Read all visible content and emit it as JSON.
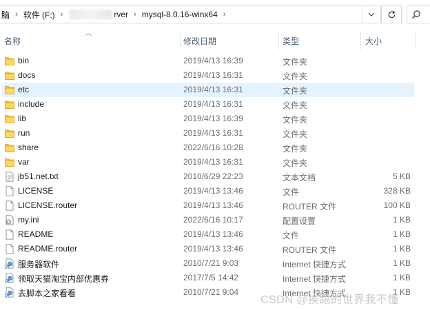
{
  "address": {
    "crumbs": [
      "脑",
      "软件 (F:)",
      "rver",
      "mysql-8.0.16-winx64"
    ],
    "separator": "›"
  },
  "columns": {
    "name": "名称",
    "date": "修改日期",
    "type": "类型",
    "size": "大小"
  },
  "files": [
    {
      "name": "bin",
      "date": "2019/4/13 16:39",
      "type": "文件夹",
      "size": "",
      "icon": "folder-icon"
    },
    {
      "name": "docs",
      "date": "2019/4/13 16:31",
      "type": "文件夹",
      "size": "",
      "icon": "folder-icon"
    },
    {
      "name": "etc",
      "date": "2019/4/13 16:31",
      "type": "文件夹",
      "size": "",
      "icon": "folder-icon",
      "selected": true
    },
    {
      "name": "include",
      "date": "2019/4/13 16:31",
      "type": "文件夹",
      "size": "",
      "icon": "folder-icon"
    },
    {
      "name": "lib",
      "date": "2019/4/13 16:39",
      "type": "文件夹",
      "size": "",
      "icon": "folder-icon"
    },
    {
      "name": "run",
      "date": "2019/4/13 16:31",
      "type": "文件夹",
      "size": "",
      "icon": "folder-icon"
    },
    {
      "name": "share",
      "date": "2022/6/16 10:28",
      "type": "文件夹",
      "size": "",
      "icon": "folder-icon"
    },
    {
      "name": "var",
      "date": "2019/4/13 16:31",
      "type": "文件夹",
      "size": "",
      "icon": "folder-icon"
    },
    {
      "name": "jb51.net.txt",
      "date": "2010/6/29 22:23",
      "type": "文本文档",
      "size": "5 KB",
      "icon": "text-file-icon"
    },
    {
      "name": "LICENSE",
      "date": "2019/4/13 13:46",
      "type": "文件",
      "size": "328 KB",
      "icon": "file-icon"
    },
    {
      "name": "LICENSE.router",
      "date": "2019/4/13 13:46",
      "type": "ROUTER 文件",
      "size": "100 KB",
      "icon": "file-icon"
    },
    {
      "name": "my.ini",
      "date": "2022/6/16 10:17",
      "type": "配置设置",
      "size": "1 KB",
      "icon": "settings-file-icon"
    },
    {
      "name": "README",
      "date": "2019/4/13 13:46",
      "type": "文件",
      "size": "1 KB",
      "icon": "file-icon"
    },
    {
      "name": "README.router",
      "date": "2019/4/13 13:46",
      "type": "ROUTER 文件",
      "size": "1 KB",
      "icon": "file-icon"
    },
    {
      "name": "服务器软件",
      "date": "2010/7/21 9:03",
      "type": "Internet 快捷方式",
      "size": "1 KB",
      "icon": "shortcut-icon"
    },
    {
      "name": "领取天猫淘宝内部优惠券",
      "date": "2017/7/5 14:42",
      "type": "Internet 快捷方式",
      "size": "1 KB",
      "icon": "shortcut-icon"
    },
    {
      "name": "去脚本之家看看",
      "date": "2010/7/21 9:04",
      "type": "Internet 快捷方式",
      "size": "1 KB",
      "icon": "shortcut-icon"
    }
  ],
  "watermark": "CSDN @挨踢的世界我不懂",
  "colors": {
    "selection": "#e5f3ff",
    "folder": "#f5c342",
    "header_text": "#4c607a"
  }
}
